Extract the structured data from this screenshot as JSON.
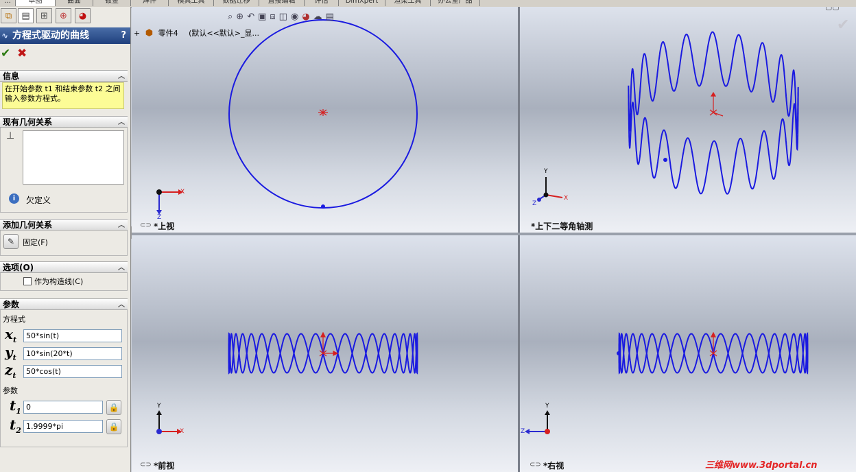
{
  "top_tabs": [
    "...",
    "草图",
    "曲面",
    "钣金",
    "焊件",
    "模具工具",
    "数据迁移",
    "直接编辑",
    "评估",
    "DimXpert",
    "渲染工具",
    "办公室产品"
  ],
  "left_panel": {
    "title": "方程式驱动的曲线",
    "help": "?",
    "ok_icon": "check-icon",
    "cancel_icon": "x-icon",
    "info": {
      "header": "信息",
      "text": "在开始参数 t1 和结束参数 t2 之间输入参数方程式。"
    },
    "existing_relations": {
      "header": "现有几何关系",
      "status": "欠定义"
    },
    "add_relations": {
      "header": "添加几何关系",
      "fixed_label": "固定(F)"
    },
    "options": {
      "header": "选项(O)",
      "construction_label": "作为构造线(C)"
    },
    "parameters": {
      "header": "参数",
      "equation_label": "方程式",
      "xt": "50*sin(t)",
      "yt": "10*sin(20*t)",
      "zt": "50*cos(t)",
      "param_label": "参数",
      "t1": "0",
      "t2": "1.9999*pi"
    }
  },
  "tree": {
    "expand": "+",
    "part_name": "零件4",
    "config": "(默认<<默认>_显..."
  },
  "viewports": {
    "top": "*上视",
    "iso": "*上下二等角轴测",
    "front": "*前视",
    "right": "*右视"
  },
  "triad_labels": {
    "x": "X",
    "y": "Y",
    "z": "Z"
  },
  "colors": {
    "curve": "#1a1ae0",
    "axis_red": "#d62020",
    "title_blue": "#2a4f8f"
  },
  "watermark": "三维网www.3dportal.cn"
}
